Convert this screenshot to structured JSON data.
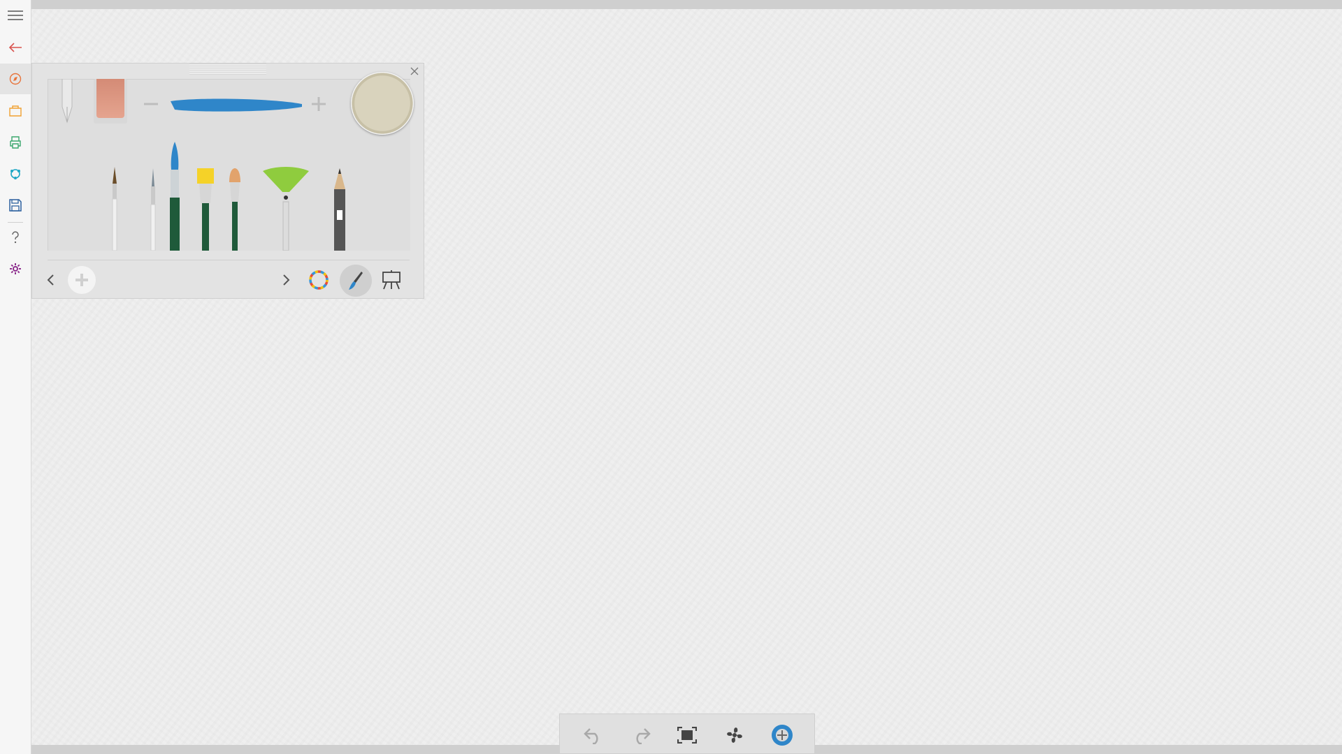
{
  "sidebar": {
    "items": [
      {
        "name": "menu",
        "icon": "hamburger-menu-icon",
        "color": "#555555"
      },
      {
        "name": "back",
        "icon": "back-arrow-icon",
        "color": "#d9534f"
      },
      {
        "name": "brush-tools",
        "icon": "compass-icon",
        "color": "#e8743b"
      },
      {
        "name": "open",
        "icon": "folder-icon",
        "color": "#f0a030"
      },
      {
        "name": "print",
        "icon": "printer-icon",
        "color": "#3aa76d"
      },
      {
        "name": "share",
        "icon": "share-icon",
        "color": "#1ea7c5"
      },
      {
        "name": "save",
        "icon": "save-icon",
        "color": "#2a5f9e"
      },
      {
        "name": "help",
        "icon": "help-icon",
        "color": "#666666"
      },
      {
        "name": "settings",
        "icon": "gear-icon",
        "color": "#8e2f8e"
      }
    ]
  },
  "brush_panel": {
    "tools": [
      "pen-nib",
      "eraser"
    ],
    "brushes": [
      "round-fine",
      "liner",
      "round-blue",
      "flat-yellow",
      "filbert",
      "fan",
      "pencil"
    ],
    "stroke_color": "#2f86c9",
    "swatch_color": "#d9d3bd",
    "selected_tab": "brushes"
  },
  "bottom_toolbar": {
    "buttons": [
      "undo",
      "redo",
      "fit-to-screen",
      "fan-dry",
      "navigator"
    ]
  }
}
